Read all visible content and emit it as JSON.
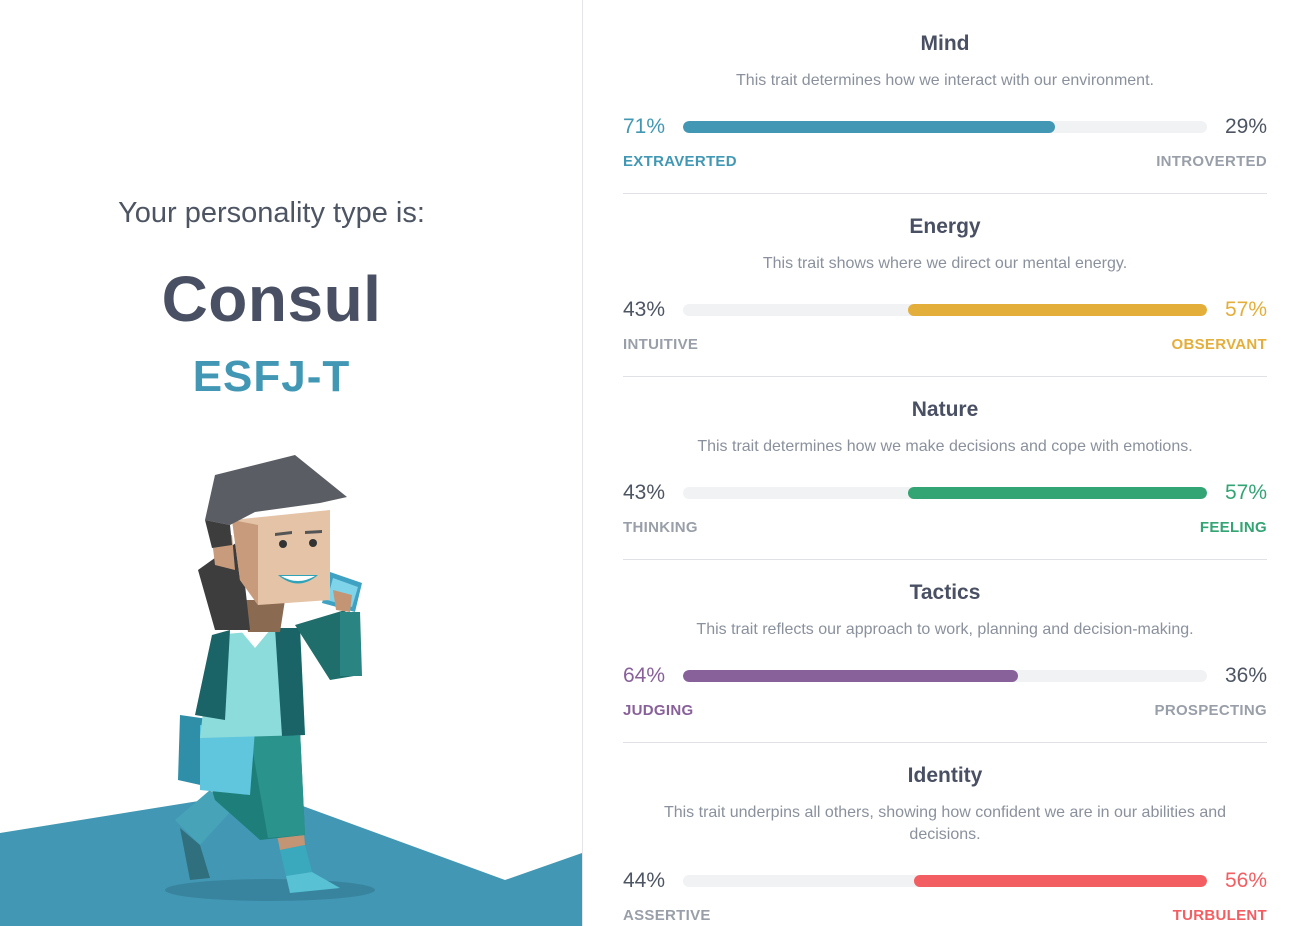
{
  "result": {
    "intro": "Your personality type is:",
    "type_name": "Consul",
    "type_code": "ESFJ-T"
  },
  "colors": {
    "mind": "#4298b4",
    "energy": "#e4ae3a",
    "nature": "#33a474",
    "tactics": "#88619a",
    "identity": "#f25e62",
    "neutral_text": "#4d5563",
    "muted_label": "#999fa8",
    "track": "#f1f2f3"
  },
  "traits": [
    {
      "title": "Mind",
      "description": "This trait determines how we interact with our environment.",
      "left_pct": "71%",
      "right_pct": "29%",
      "left_label": "EXTRAVERTED",
      "right_label": "INTROVERTED",
      "dominant": "left",
      "fill_percent": 71,
      "color": "#4298b4"
    },
    {
      "title": "Energy",
      "description": "This trait shows where we direct our mental energy.",
      "left_pct": "43%",
      "right_pct": "57%",
      "left_label": "INTUITIVE",
      "right_label": "OBSERVANT",
      "dominant": "right",
      "fill_percent": 57,
      "color": "#e4ae3a"
    },
    {
      "title": "Nature",
      "description": "This trait determines how we make decisions and cope with emotions.",
      "left_pct": "43%",
      "right_pct": "57%",
      "left_label": "THINKING",
      "right_label": "FEELING",
      "dominant": "right",
      "fill_percent": 57,
      "color": "#33a474"
    },
    {
      "title": "Tactics",
      "description": "This trait reflects our approach to work, planning and decision-making.",
      "left_pct": "64%",
      "right_pct": "36%",
      "left_label": "JUDGING",
      "right_label": "PROSPECTING",
      "dominant": "left",
      "fill_percent": 64,
      "color": "#88619a"
    },
    {
      "title": "Identity",
      "description": "This trait underpins all others, showing how confident we are in our abilities and decisions.",
      "left_pct": "44%",
      "right_pct": "56%",
      "left_label": "ASSERTIVE",
      "right_label": "TURBULENT",
      "dominant": "right",
      "fill_percent": 56,
      "color": "#f25e62"
    }
  ]
}
